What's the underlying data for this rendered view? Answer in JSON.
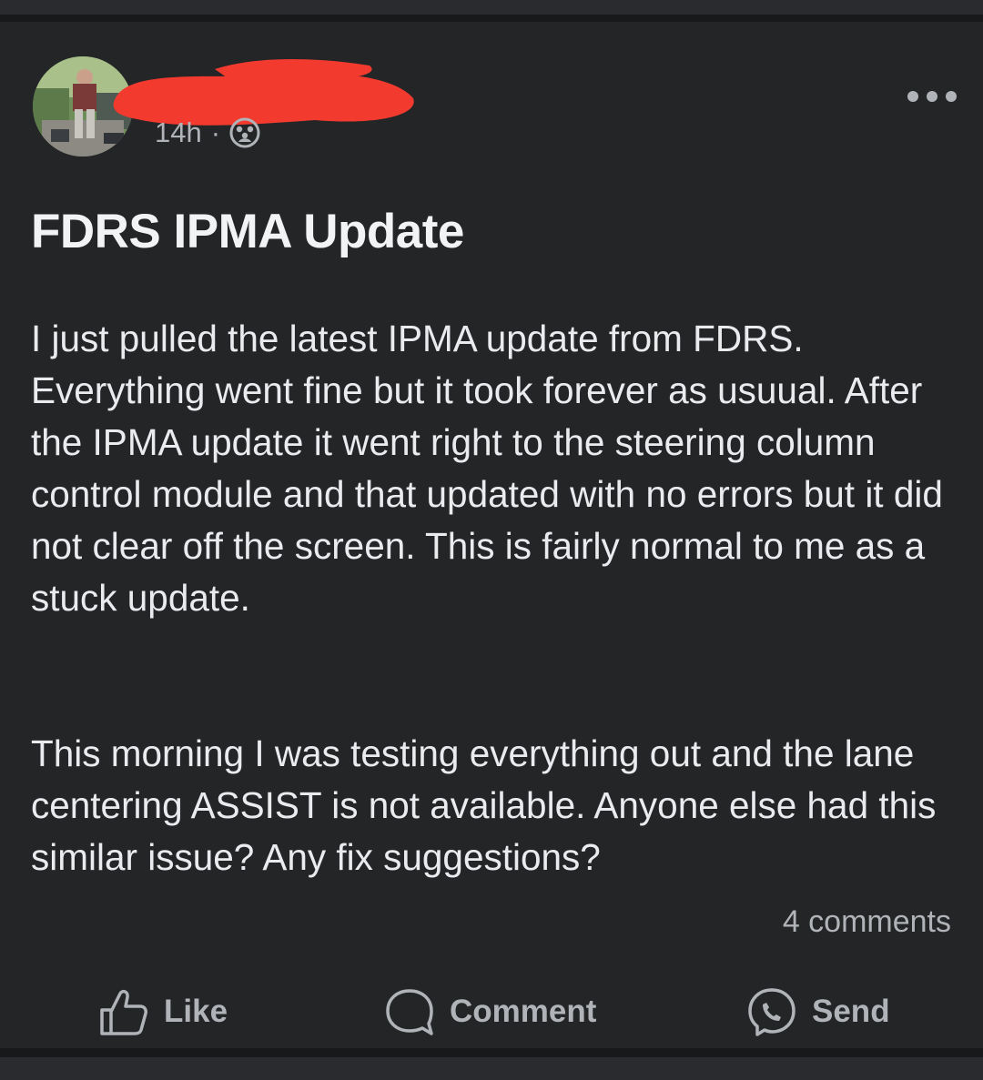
{
  "post": {
    "time": "14h",
    "separator": "·",
    "audience_icon": "group-icon",
    "title": "FDRS IPMA Update",
    "paragraphs": [
      "I just pulled the latest IPMA update from FDRS. Everything went fine but it took forever as usuual. After the IPMA update it went right to the steering column control module and that updated with no errors but it did not clear off the screen. This is fairly normal to me as a stuck update.",
      "This morning I was testing everything out and the lane centering ASSIST is not available. Anyone else had this similar issue? Any fix suggestions?"
    ],
    "comments_count": "4 comments"
  },
  "actions": {
    "like": "Like",
    "comment": "Comment",
    "send": "Send"
  },
  "colors": {
    "card_background": "#242527",
    "page_background": "#18191b",
    "primary_text": "#e9ebee",
    "secondary_text": "#b0b3b8",
    "redaction": "#f23a2f"
  }
}
